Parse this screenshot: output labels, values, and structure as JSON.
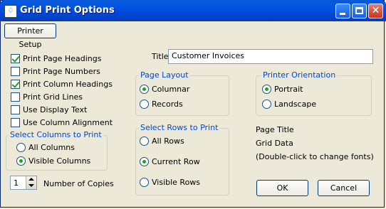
{
  "window": {
    "title": "Grid Print Options"
  },
  "toolbar": {
    "printer_setup": "Printer Setup"
  },
  "options": [
    {
      "label": "Print Page Headings",
      "checked": true
    },
    {
      "label": "Print Page Numbers",
      "checked": false
    },
    {
      "label": "Print Column Headings",
      "checked": true
    },
    {
      "label": "Print Grid Lines",
      "checked": false
    },
    {
      "label": "Use Display Text",
      "checked": false
    },
    {
      "label": "Use Column Alignment",
      "checked": false
    }
  ],
  "title_field": {
    "label": "Title",
    "value": "Customer Invoices"
  },
  "page_layout": {
    "title": "Page Layout",
    "options": [
      "Columnar",
      "Records"
    ],
    "selected": "Columnar"
  },
  "printer_orientation": {
    "title": "Printer Orientation",
    "options": [
      "Portrait",
      "Landscape"
    ],
    "selected": "Portrait"
  },
  "select_columns": {
    "title": "Select Columns to Print",
    "options": [
      "All Columns",
      "Visible Columns"
    ],
    "selected": "Visible Columns"
  },
  "select_rows": {
    "title": "Select Rows to Print",
    "options": [
      "All Rows",
      "Current Row",
      "Visible Rows"
    ],
    "selected": "Current Row"
  },
  "fonts": {
    "page_title": "Page Title",
    "grid_data": "Grid Data",
    "hint": "(Double-click to change fonts)"
  },
  "copies": {
    "value": "1",
    "label": "Number of Copies"
  },
  "buttons": {
    "ok": "OK",
    "cancel": "Cancel"
  }
}
